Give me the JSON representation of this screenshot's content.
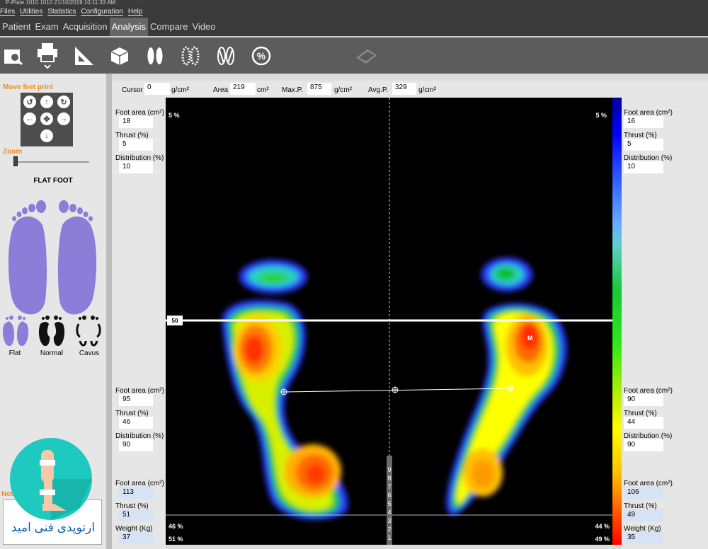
{
  "window": {
    "title": "P-Plate  1010 1010  21/10/2019  10:11:33 AM"
  },
  "menu": [
    "Files",
    "Utilities",
    "Statistics",
    "Configuration",
    "Help"
  ],
  "tabs": [
    "Patient",
    "Exam",
    "Acquisition",
    "Analysis",
    "Compare",
    "Video"
  ],
  "active_tab": "Analysis",
  "toolbar_icons": [
    "search-document-icon",
    "print-icon",
    "ruler-icon",
    "cube-icon",
    "footprints-icon",
    "dotted-footprints-icon",
    "foot-axis-icon",
    "percent-icon",
    "scanner-icon"
  ],
  "sidebar": {
    "move_title": "Move feet print",
    "zoom_label": "Zoom",
    "foot_type": "FLAT FOOT",
    "types": [
      "Flat",
      "Normal",
      "Cavus"
    ],
    "note_label": "Not",
    "logo_text": "ارتوپدی فنی امید"
  },
  "top": {
    "cursor_label": "Cursor",
    "cursor_value": "0",
    "cursor_unit": "g/cm²",
    "area_label": "Area",
    "area_value": "219",
    "area_unit": "cm²",
    "max_label": "Max.P.",
    "max_value": "875",
    "max_unit": "g/cm²",
    "avg_label": "Avg.P.",
    "avg_value": "329",
    "avg_unit": "g/cm²"
  },
  "left": {
    "top": {
      "area_label": "Foot area (cm²)",
      "area": "18",
      "thrust_label": "Thrust (%)",
      "thrust": "5",
      "dist_label": "Distribution (%)",
      "dist": "10"
    },
    "mid": {
      "area_label": "Foot area (cm²)",
      "area": "95",
      "thrust_label": "Thrust (%)",
      "thrust": "46",
      "dist_label": "Distribution (%)",
      "dist": "90"
    },
    "bot": {
      "area_label": "Foot area (cm²)",
      "area": "113",
      "thrust_label": "Thrust (%)",
      "thrust": "51",
      "weight_label": "Weight (Kg)",
      "weight": "37"
    }
  },
  "right": {
    "top": {
      "area_label": "Foot area (cm²)",
      "area": "16",
      "thrust_label": "Thrust (%)",
      "thrust": "5",
      "dist_label": "Distribution (%)",
      "dist": "10"
    },
    "mid": {
      "area_label": "Foot area (cm²)",
      "area": "90",
      "thrust_label": "Thrust (%)",
      "thrust": "44",
      "dist_label": "Distribution (%)",
      "dist": "90"
    },
    "bot": {
      "area_label": "Foot area (cm²)",
      "area": "106",
      "thrust_label": "Thrust (%)",
      "thrust": "49",
      "weight_label": "Weight (Kg)",
      "weight": "35"
    }
  },
  "plot": {
    "tl_pct": "5 %",
    "tr_pct": "5 %",
    "bl1": "46 %",
    "br1": "44 %",
    "bl2": "51 %",
    "br2": "49 %",
    "line_label": "50",
    "max_marker": "M",
    "scale_digits": [
      "9",
      "8",
      "7",
      "6",
      "5",
      "4",
      "3",
      "2",
      "1"
    ]
  },
  "colors": {
    "bg": "#dcdcdc",
    "menubar": "#3a3a3a",
    "toolbar": "#5c5c5c",
    "accent": "#f08c1e",
    "foot_purple": "#8b7dd8"
  }
}
